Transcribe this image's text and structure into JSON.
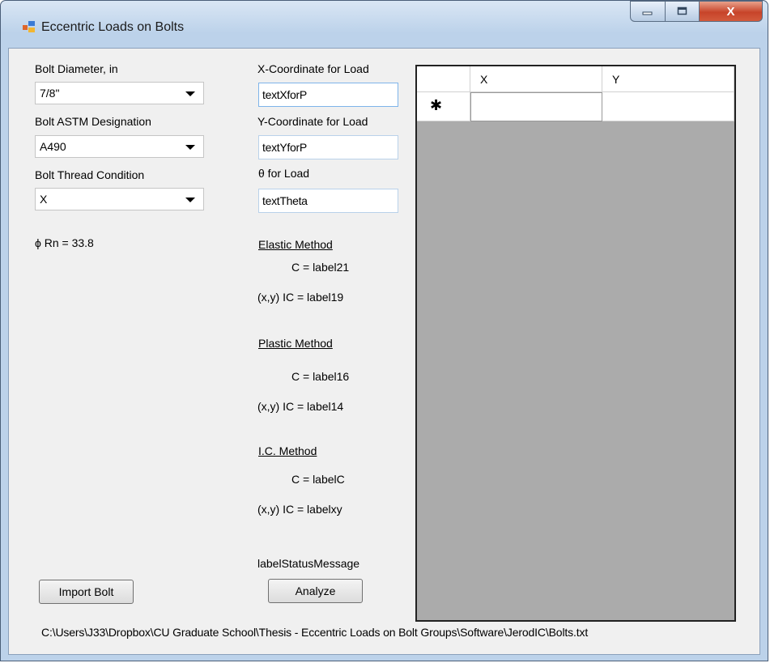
{
  "window": {
    "title": "Eccentric Loads on Bolts",
    "controls": {
      "minimize": "",
      "maximize": "",
      "close": "X"
    }
  },
  "left": {
    "bolt_diameter_label": "Bolt Diameter, in",
    "bolt_diameter_value": "7/8\"",
    "astm_label": "Bolt ASTM Designation",
    "astm_value": "A490",
    "thread_label": "Bolt Thread Condition",
    "thread_value": "X",
    "phi_rn": "ϕ Rn = 33.8",
    "import_button": "Import Bolt"
  },
  "middle": {
    "x_coord_label": "X-Coordinate for Load",
    "x_coord_value": "textXforP",
    "y_coord_label": "Y-Coordinate for Load",
    "y_coord_value": "textYforP",
    "theta_label": "θ for Load",
    "theta_value": "textTheta",
    "elastic": {
      "heading": "Elastic Method",
      "c": "C = label21",
      "ic": "(x,y) IC = label19"
    },
    "plastic": {
      "heading": "Plastic Method",
      "c": "C = label16",
      "ic": "(x,y) IC = label14"
    },
    "ic_method": {
      "heading": "I.C. Method",
      "c": "C = labelC",
      "ic": "(x,y) IC = labelxy"
    },
    "status": "labelStatusMessage",
    "analyze_button": "Analyze"
  },
  "grid": {
    "columns": [
      "X",
      "Y"
    ],
    "new_row_marker": "✱"
  },
  "footer_path": "C:\\Users\\J33\\Dropbox\\CU Graduate School\\Thesis - Eccentric Loads on Bolt Groups\\Software\\JerodIC\\Bolts.txt"
}
